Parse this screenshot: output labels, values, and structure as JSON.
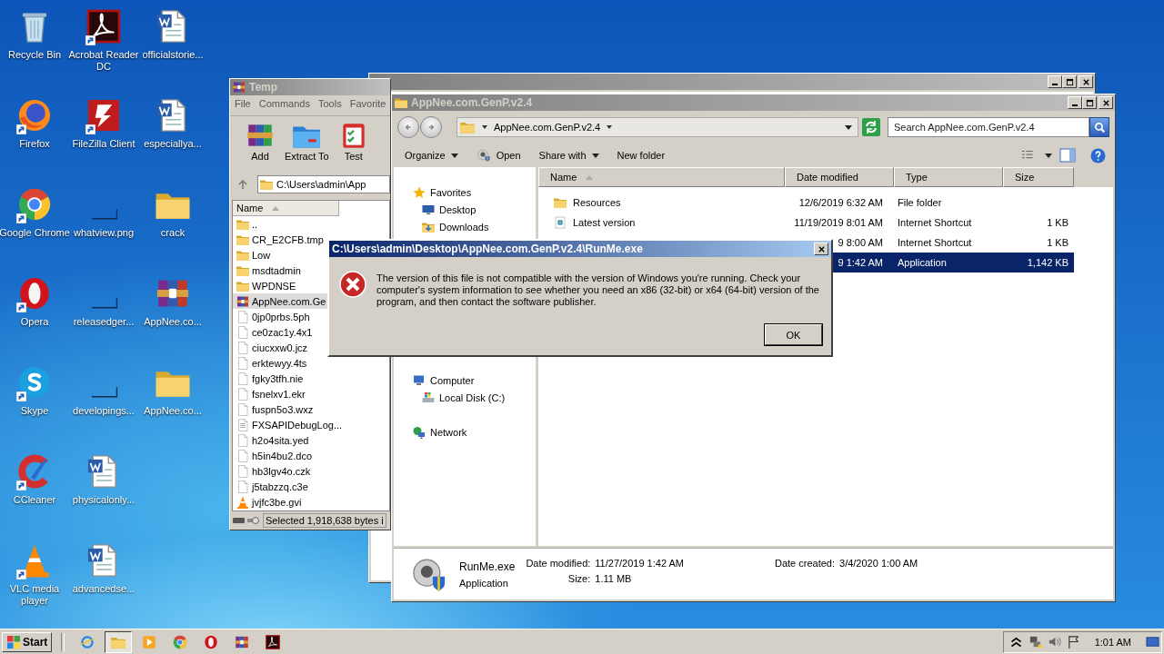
{
  "desktop_icons": [
    {
      "label": "Recycle Bin",
      "kind": "recycle",
      "shortcut": false
    },
    {
      "label": "Firefox",
      "kind": "firefox",
      "shortcut": true
    },
    {
      "label": "Google Chrome",
      "kind": "chrome",
      "shortcut": true
    },
    {
      "label": "Opera",
      "kind": "opera",
      "shortcut": true
    },
    {
      "label": "Skype",
      "kind": "skype",
      "shortcut": true
    },
    {
      "label": "CCleaner",
      "kind": "ccleaner",
      "shortcut": true
    },
    {
      "label": "VLC media player",
      "kind": "vlc",
      "shortcut": true
    },
    {
      "label": "Acrobat Reader DC",
      "kind": "acrobat",
      "shortcut": true
    },
    {
      "label": "FileZilla Client",
      "kind": "filezilla",
      "shortcut": true
    },
    {
      "label": "whatview.png",
      "kind": "blank",
      "shortcut": false
    },
    {
      "label": "releasedger...",
      "kind": "blank",
      "shortcut": false
    },
    {
      "label": "developings...",
      "kind": "blank",
      "shortcut": false
    },
    {
      "label": "physicalonly...",
      "kind": "word",
      "shortcut": false
    },
    {
      "label": "advancedse...",
      "kind": "word",
      "shortcut": false
    },
    {
      "label": "officialstorie...",
      "kind": "word",
      "shortcut": false
    },
    {
      "label": "especiallya...",
      "kind": "word",
      "shortcut": false
    },
    {
      "label": "crack",
      "kind": "folder",
      "shortcut": false
    },
    {
      "label": "AppNee.co...",
      "kind": "winrar",
      "shortcut": false
    },
    {
      "label": "AppNee.co...",
      "kind": "folder",
      "shortcut": false
    }
  ],
  "winrar_window": {
    "title": "Temp",
    "menu": [
      "File",
      "Commands",
      "Tools",
      "Favorite"
    ],
    "toolbar": [
      {
        "label": "Add",
        "kind": "add"
      },
      {
        "label": "Extract To",
        "kind": "extract"
      },
      {
        "label": "Test",
        "kind": "test"
      }
    ],
    "path": "C:\\Users\\admin\\App",
    "column": "Name",
    "files": [
      {
        "name": "..",
        "kind": "folder",
        "selected": false
      },
      {
        "name": "CR_E2CFB.tmp",
        "kind": "folder",
        "selected": false
      },
      {
        "name": "Low",
        "kind": "folder",
        "selected": false
      },
      {
        "name": "msdtadmin",
        "kind": "folder",
        "selected": false
      },
      {
        "name": "WPDNSE",
        "kind": "folder",
        "selected": false
      },
      {
        "name": "AppNee.com.Ge",
        "kind": "winrar",
        "selected": true
      },
      {
        "name": "0jp0prbs.5ph",
        "kind": "file",
        "selected": false
      },
      {
        "name": "ce0zac1y.4x1",
        "kind": "file",
        "selected": false
      },
      {
        "name": "ciucxxw0.jcz",
        "kind": "file",
        "selected": false
      },
      {
        "name": "erktewyy.4ts",
        "kind": "file",
        "selected": false
      },
      {
        "name": "fgky3tfh.nie",
        "kind": "file",
        "selected": false
      },
      {
        "name": "fsnelxv1.ekr",
        "kind": "file",
        "selected": false
      },
      {
        "name": "fuspn5o3.wxz",
        "kind": "file",
        "selected": false
      },
      {
        "name": "FXSAPIDebugLog...",
        "kind": "text",
        "selected": false
      },
      {
        "name": "h2o4sita.yed",
        "kind": "file",
        "selected": false
      },
      {
        "name": "h5in4bu2.dco",
        "kind": "file",
        "selected": false
      },
      {
        "name": "hb3lgv4o.czk",
        "kind": "file",
        "selected": false
      },
      {
        "name": "j5tabzzq.c3e",
        "kind": "file",
        "selected": false
      },
      {
        "name": "jvjfc3be.gvi",
        "kind": "vlc",
        "selected": false
      }
    ],
    "status": "Selected 1,918,638 bytes i"
  },
  "explorer": {
    "title": "AppNee.com.GenP.v2.4",
    "breadcrumb": "AppNee.com.GenP.v2.4",
    "search_placeholder": "Search AppNee.com.GenP.v2.4",
    "commands": [
      {
        "label": "Organize",
        "kind": "menu"
      },
      {
        "label": "Open",
        "kind": "open"
      },
      {
        "label": "Share with",
        "kind": "menu"
      },
      {
        "label": "New folder",
        "kind": "plain"
      }
    ],
    "nav": [
      {
        "label": "Favorites",
        "kind": "favorites",
        "children": [
          {
            "label": "Desktop",
            "kind": "desktop"
          },
          {
            "label": "Downloads",
            "kind": "downloads"
          }
        ]
      },
      {
        "label": "Computer",
        "kind": "computer",
        "children": [
          {
            "label": "Local Disk (C:)",
            "kind": "disk"
          }
        ]
      },
      {
        "label": "Network",
        "kind": "network"
      }
    ],
    "columns": [
      {
        "label": "Name",
        "sorted": true
      },
      {
        "label": "Date modified",
        "sorted": false
      },
      {
        "label": "Type",
        "sorted": false
      },
      {
        "label": "Size",
        "sorted": false
      }
    ],
    "rows": [
      {
        "name": "Resources",
        "kind": "folder",
        "date": "12/6/2019 6:32 AM",
        "type": "File folder",
        "selected": false
      },
      {
        "name": "Latest version",
        "kind": "shortcut",
        "date": "11/19/2019 8:01 AM",
        "type": "Internet Shortcut",
        "size": "1 KB",
        "selected": false
      },
      {
        "date": "9 8:00 AM",
        "type": "Internet Shortcut",
        "size": "1 KB",
        "selected": false
      },
      {
        "date": "9 1:42 AM",
        "type": "Application",
        "size": "1,142 KB",
        "selected": true
      }
    ],
    "details": {
      "name": "RunMe.exe",
      "type": "Application",
      "field_columns": [
        [
          {
            "label": "Date modified:",
            "value": "11/27/2019 1:42 AM"
          },
          {
            "label": "Size:",
            "value": "1.11 MB"
          }
        ],
        [
          {
            "label": "Date created:",
            "value": "3/4/2020 1:00 AM"
          }
        ]
      ]
    }
  },
  "dialog": {
    "title": "C:\\Users\\admin\\Desktop\\AppNee.com.GenP.v2.4\\RunMe.exe",
    "message": "The version of this file is not compatible with the version of Windows you're running. Check your computer's system information to see whether you need an x86 (32-bit) or x64 (64-bit) version of the program, and then contact the software publisher.",
    "buttons": [
      "OK"
    ]
  },
  "taskbar": {
    "start": "Start",
    "apps": [
      {
        "kind": "ie",
        "active": false
      },
      {
        "kind": "folder",
        "active": true
      },
      {
        "kind": "media",
        "active": false
      },
      {
        "kind": "chrome",
        "active": false
      },
      {
        "kind": "opera",
        "active": false
      },
      {
        "kind": "winrar",
        "active": false
      },
      {
        "kind": "acrobat",
        "active": false
      }
    ],
    "clock": "1:01 AM"
  }
}
